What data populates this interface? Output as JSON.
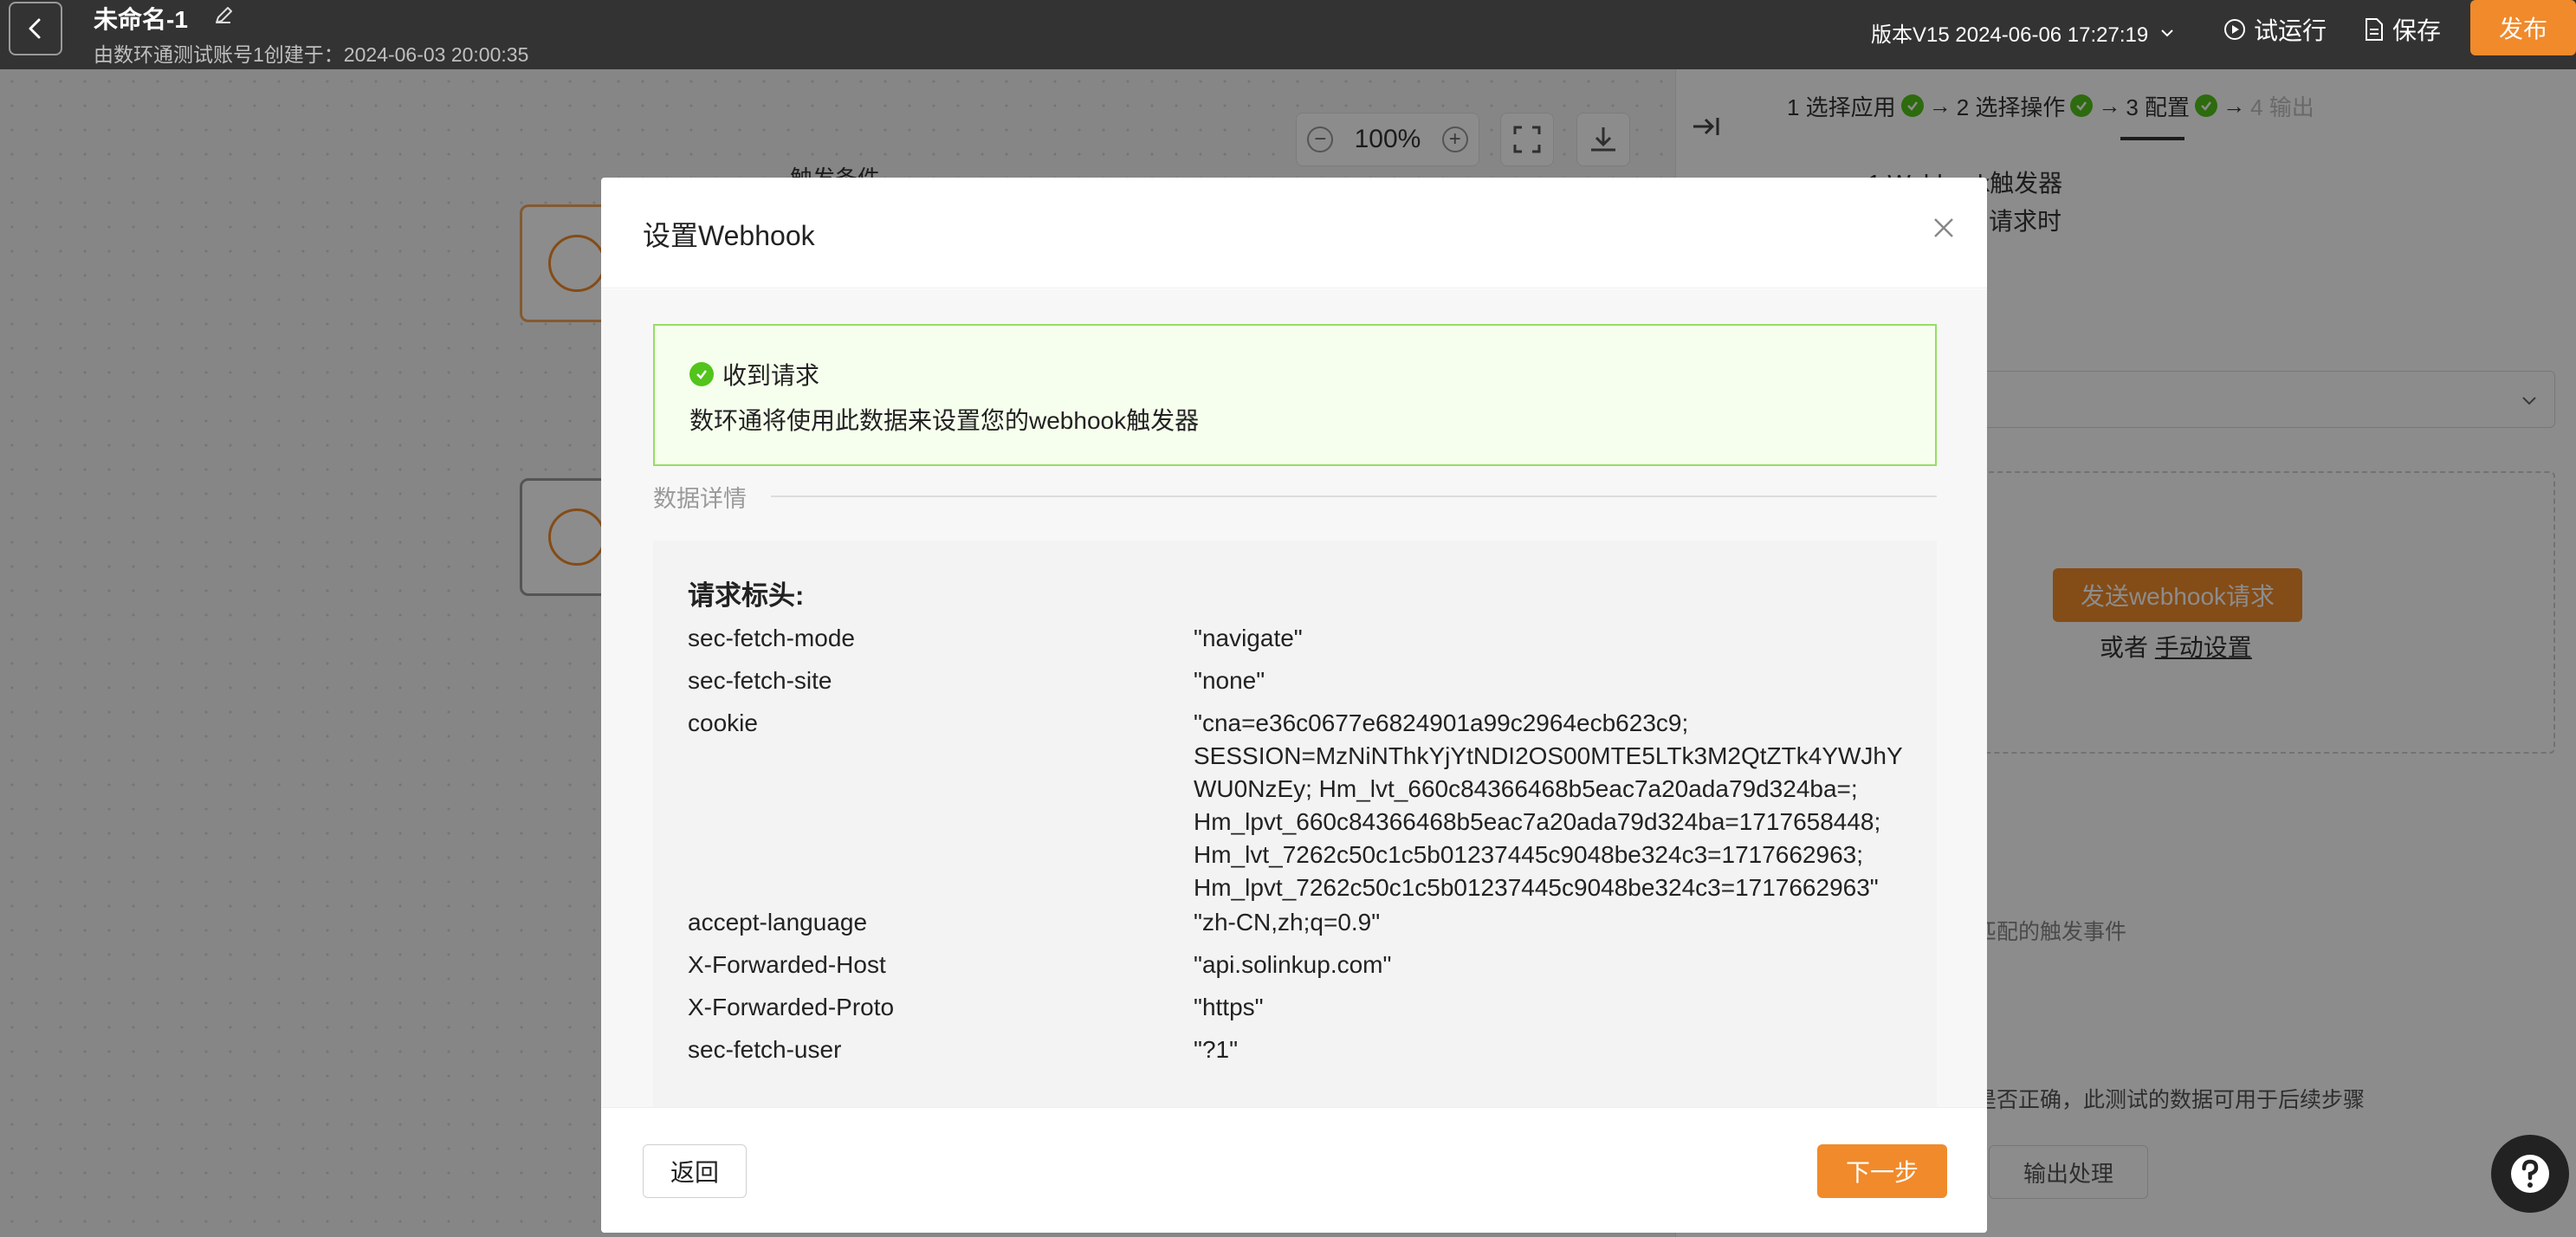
{
  "header": {
    "app_name": "未命名-1",
    "subtitle": "由数环通测试账号1创建于：2024-06-03 20:00:35",
    "version": "版本V15 2024-06-06 17:27:19",
    "run_label": "试运行",
    "save_label": "保存",
    "publish_label": "发布"
  },
  "canvas": {
    "zoom": "100%",
    "node_title": "触发条件"
  },
  "right_panel": {
    "steps": [
      {
        "label": "1 选择应用",
        "done": true
      },
      {
        "label": "2 选择操作",
        "done": true
      },
      {
        "label": "3 配置",
        "done": true
      },
      {
        "label": "4 输出",
        "done": false
      }
    ],
    "trigger_name": "1.Webhook触发器",
    "trigger_desc": "请求时",
    "send_webhook_label": "发送webhook请求",
    "or_text": "或者",
    "manual_setup_label": "手动设置",
    "match_text": "匹配的触发事件",
    "test_hint": "是否正确，此测试的数据可用于后续步骤",
    "output_btn_label": "输出处理"
  },
  "modal": {
    "title": "设置Webhook",
    "success_title": "收到请求",
    "success_desc": "数环通将使用此数据来设置您的webhook触发器",
    "divider_label": "数据详情",
    "section_title": "请求标头:",
    "headers": [
      {
        "key": "sec-fetch-mode",
        "value": "\"navigate\""
      },
      {
        "key": "sec-fetch-site",
        "value": "\"none\""
      },
      {
        "key": "cookie",
        "value": "\"cna=e36c0677e6824901a99c2964ecb623c9;\nSESSION=MzNiNThkYjYtNDI2OS00MTE5LTk3M2QtZTk4YWJhY\nWU0NzEy; Hm_lvt_660c84366468b5eac7a20ada79d324ba=;\nHm_lpvt_660c84366468b5eac7a20ada79d324ba=1717658448;\nHm_lvt_7262c50c1c5b01237445c9048be324c3=1717662963;\nHm_lpvt_7262c50c1c5b01237445c9048be324c3=1717662963\""
      },
      {
        "key": "accept-language",
        "value": "\"zh-CN,zh;q=0.9\""
      },
      {
        "key": "X-Forwarded-Host",
        "value": "\"api.solinkup.com\""
      },
      {
        "key": "X-Forwarded-Proto",
        "value": "\"https\""
      },
      {
        "key": "sec-fetch-user",
        "value": "\"?1\""
      }
    ],
    "back_label": "返回",
    "next_label": "下一步"
  },
  "colors": {
    "accent": "#f08a2b",
    "header_bg": "#333333",
    "success_green": "#52c41a",
    "success_border": "#95de64",
    "success_bg": "#f6ffed"
  }
}
